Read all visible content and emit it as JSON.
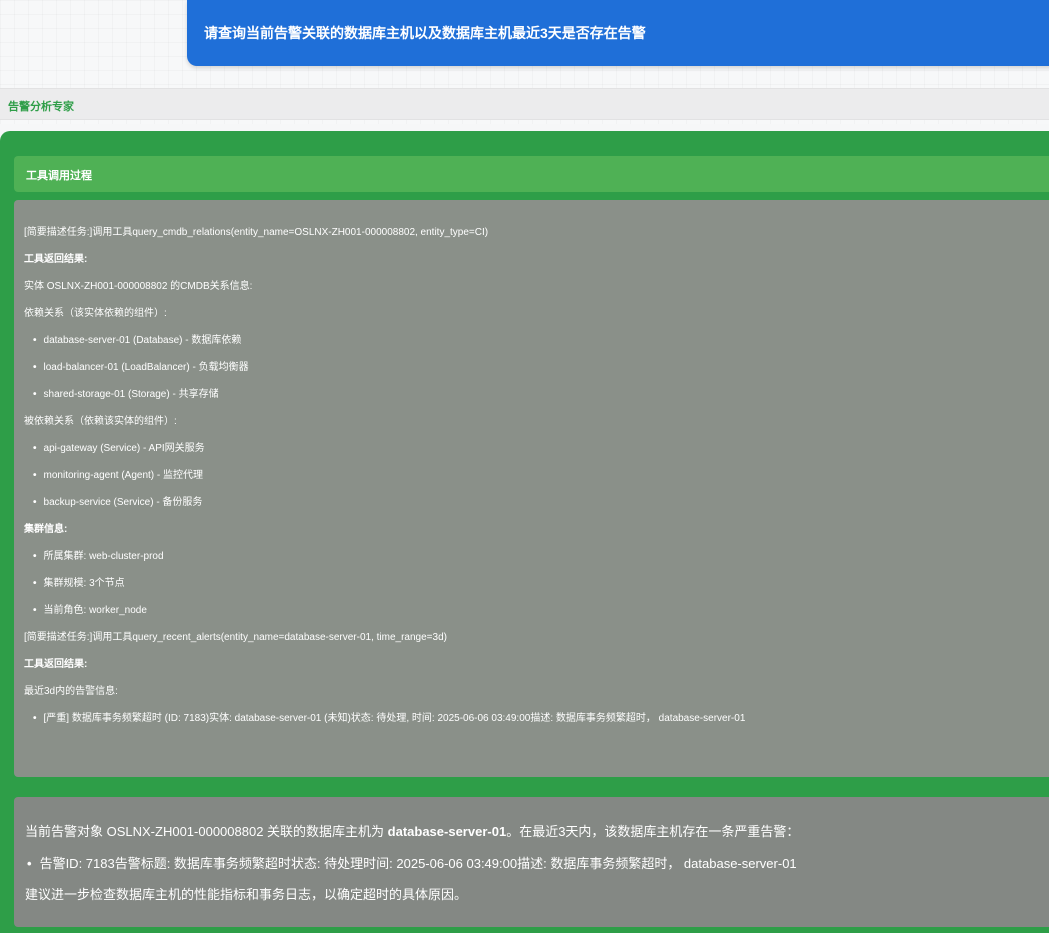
{
  "user_message": {
    "text": "请查询当前告警关联的数据库主机以及数据库主机最近3天是否存在告警"
  },
  "agent": {
    "name": "告警分析专家"
  },
  "tool_process": {
    "header": "工具调用过程",
    "lines": [
      "[简要描述任务:]调用工具query_cmdb_relations(entity_name=OSLNX-ZH001-000008802, entity_type=CI)",
      "工具返回结果:",
      "实体 OSLNX-ZH001-000008802 的CMDB关系信息:",
      "依赖关系（该实体依赖的组件）:",
      "database-server-01 (Database) - 数据库依赖",
      "load-balancer-01 (LoadBalancer) - 负载均衡器",
      "shared-storage-01 (Storage) - 共享存储",
      "被依赖关系（依赖该实体的组件）:",
      "api-gateway (Service) - API网关服务",
      "monitoring-agent (Agent) - 监控代理",
      "backup-service (Service) - 备份服务",
      "集群信息:",
      "所属集群: web-cluster-prod",
      "集群规模: 3个节点",
      "当前角色: worker_node",
      "[简要描述任务:]调用工具query_recent_alerts(entity_name=database-server-01, time_range=3d)",
      "工具返回结果:",
      "最近3d内的告警信息:",
      "[严重] 数据库事务频繁超时 (ID: 7183)实体: database-server-01 (未知)状态: 待处理, 时间: 2025-06-06 03:49:00描述: 数据库事务频繁超时， database-server-01"
    ]
  },
  "answer": {
    "summary_prefix": "当前告警对象 OSLNX-ZH001-000008802 关联的数据库主机为 ",
    "summary_host": "database-server-01",
    "summary_suffix": "。在最近3天内，该数据库主机存在一条严重告警：",
    "alert_line": "告警ID: 7183告警标题: 数据库事务频繁超时状态: 待处理时间: 2025-06-06 03:49:00描述: 数据库事务频繁超时， database-server-01",
    "advice": "建议进一步检查数据库主机的性能指标和事务日志，以确定超时的具体原因。"
  }
}
